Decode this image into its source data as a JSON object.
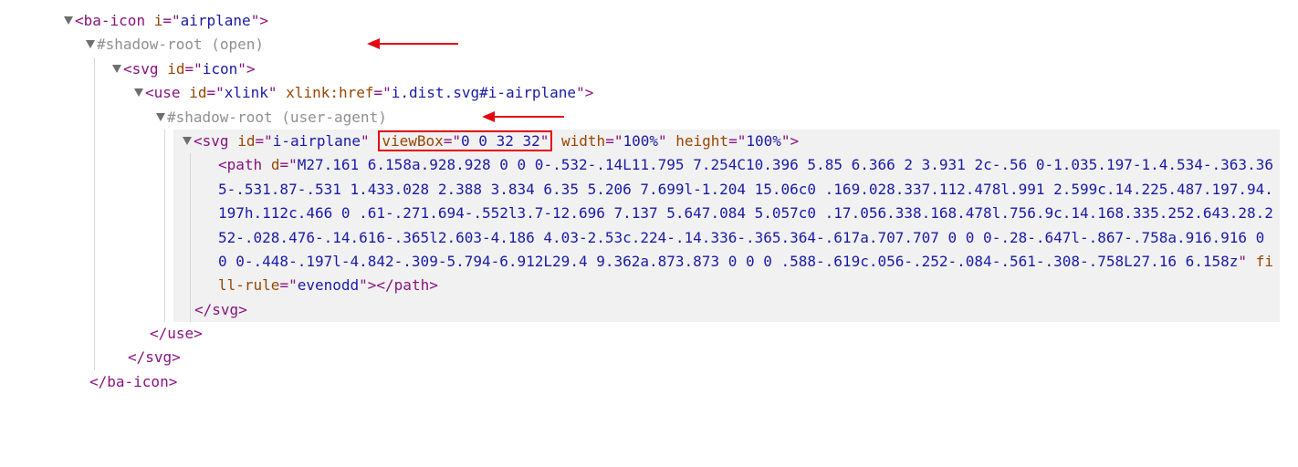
{
  "lines": {
    "baIcon_open": {
      "tag": "ba-icon",
      "attr1_name": "i",
      "attr1_val": "airplane"
    },
    "shadow1": {
      "prefix": "#shadow-root ",
      "paren": "(open)"
    },
    "svg_outer_open": {
      "tag": "svg",
      "attr1_name": "id",
      "attr1_val": "icon"
    },
    "use_open": {
      "tag": "use",
      "attr1_name": "id",
      "attr1_val": "xlink",
      "attr2_name": "xlink:href",
      "attr2_val": "i.dist.svg#i-airplane"
    },
    "shadow2": {
      "prefix": "#shadow-root ",
      "paren": "(user-agent)"
    },
    "svg_inner_open": {
      "tag": "svg",
      "attr_id_name": "id",
      "attr_id_val": "i-airplane",
      "attr_vb_name": "viewBox",
      "attr_vb_val": "0 0 32 32",
      "attr_w_name": "width",
      "attr_w_val": "100%",
      "attr_h_name": "height",
      "attr_h_val": "100%"
    },
    "path": {
      "tag_open": "path",
      "d_name": "d",
      "d_val": "M27.161 6.158a.928.928 0 0 0-.532-.14L11.795 7.254C10.396 5.85 6.366 2 3.931 2c-.56 0-1.035.197-1.4.534-.363.365-.531.87-.531 1.433.028 2.388 3.834 6.35 5.206 7.699l-1.204 15.06c0 .169.028.337.112.478l.991 2.599c.14.225.487.197.94.197h.112c.466 0 .61-.271.694-.552l3.7-12.696 7.137 5.647.084 5.057c0 .17.056.338.168.478l.756.9c.14.168.335.252.643.28.252-.028.476-.14.616-.365l2.603-4.186 4.03-2.53c.224-.14.336-.365.364-.617a.707.707 0 0 0-.28-.647l-.867-.758a.916.916 0 0 0-.448-.197l-4.842-.309-5.794-6.912L29.4 9.362a.873.873 0 0 0 .588-.619c.056-.252-.084-.561-.308-.758L27.16 6.158z",
      "fr_name": "fill-rule",
      "fr_val": "evenodd",
      "tag_close": "path"
    },
    "svg_inner_close": "svg",
    "use_close": "use",
    "svg_outer_close": "svg",
    "baIcon_close": "ba-icon"
  }
}
